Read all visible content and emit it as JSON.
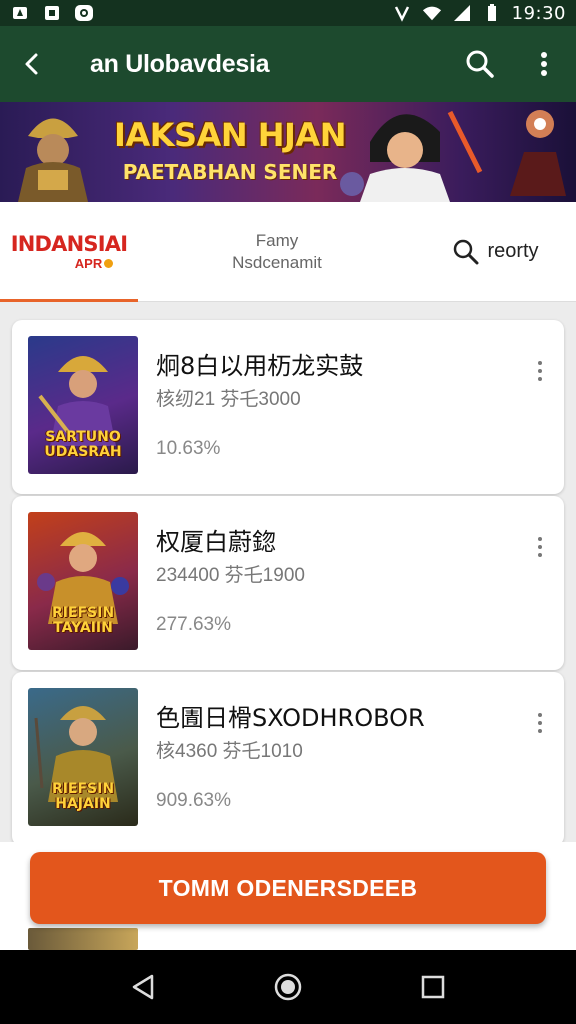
{
  "status_bar": {
    "time": "19:30"
  },
  "app_bar": {
    "title": "an Ulobavdesia"
  },
  "banner": {
    "line1": "IAKSAN HJAN",
    "line2": "PAETABHAN SENER"
  },
  "tabs": {
    "brand_top": "INDANSIAI",
    "brand_sub": "APR",
    "middle_line1": "Famy",
    "middle_line2": "Nsdcenamit",
    "search_label": "reorty"
  },
  "items": [
    {
      "title": "炯8白以用杤龙实鼓",
      "subtitle": "核纫21 芬乇3000",
      "percent": "10.63%",
      "thumb_caption": "SARTUNO UDASRAH"
    },
    {
      "title": "权厦白蔚鍃",
      "subtitle": "234400 芬乇1900",
      "percent": "277.63%",
      "thumb_caption": "RIEFSIN TAYAIIN"
    },
    {
      "title": "色圊日榾SXODHROBOR",
      "subtitle": "核4360 芬乇1010",
      "percent": "909.63%",
      "thumb_caption": "RIEFSIN HAJAIN"
    }
  ],
  "cta": {
    "label": "TOMM ODENERSDEEB"
  },
  "colors": {
    "appbar": "#1d4a2e",
    "accent": "#e3561c",
    "brand": "#d6261f"
  }
}
